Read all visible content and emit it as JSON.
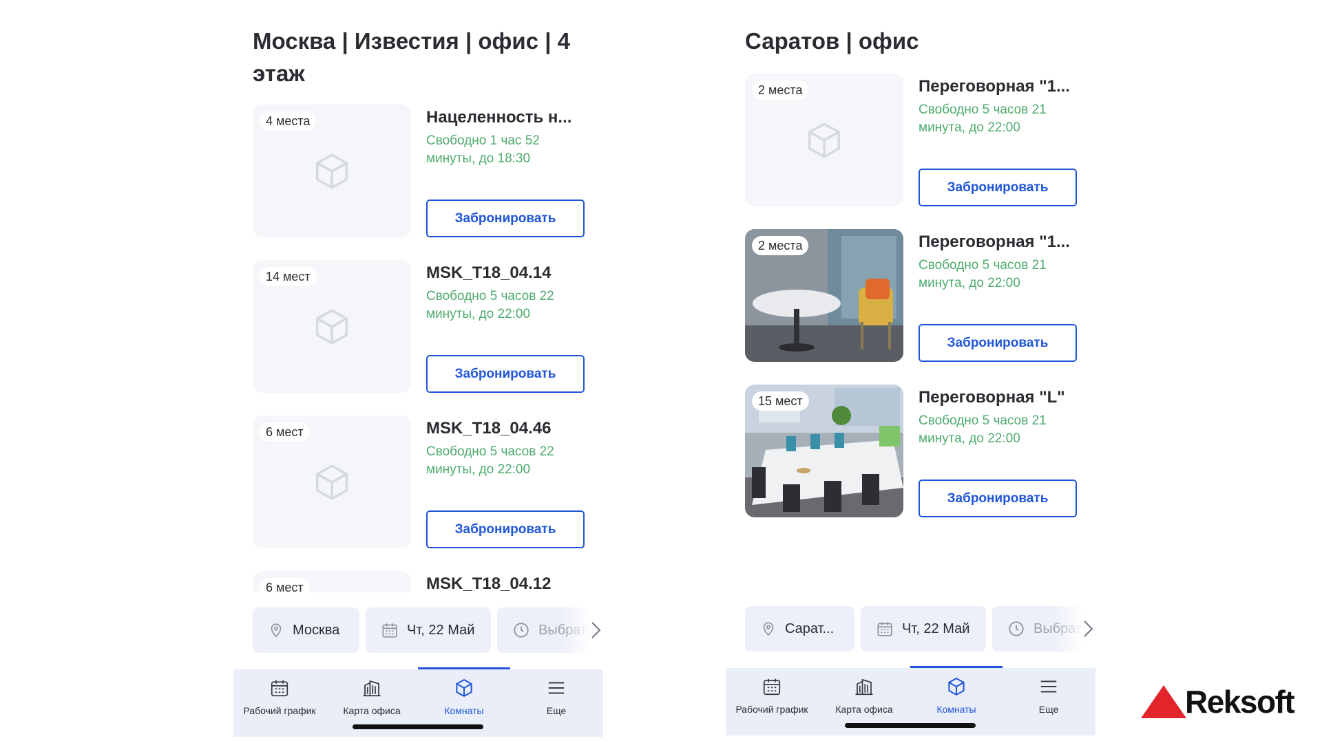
{
  "left_panel": {
    "title": "Москва | Известия | офис | 4 этаж",
    "rooms": [
      {
        "seats": "4 места",
        "name": "Нацеленность н...",
        "status": "Свободно 1 час 52 минуты, до 18:30",
        "photo": "placeholder"
      },
      {
        "seats": "14 мест",
        "name": "MSK_T18_04.14",
        "status": "Свободно 5 часов 22 минуты, до 22:00",
        "photo": "placeholder"
      },
      {
        "seats": "6 мест",
        "name": "MSK_T18_04.46",
        "status": "Свободно 5 часов 22 минуты, до 22:00",
        "photo": "placeholder"
      },
      {
        "seats": "6 мест",
        "name": "MSK_T18_04.12",
        "status": "",
        "photo": "placeholder"
      }
    ],
    "filters": {
      "city": "Москва",
      "date": "Чт, 22 Май",
      "time": "Выбрать"
    }
  },
  "right_panel": {
    "title": "Саратов | офис",
    "rooms": [
      {
        "seats": "2 места",
        "name": "Переговорная \"1...",
        "status": "Свободно 5 часов 21 минута, до 22:00",
        "photo": "placeholder"
      },
      {
        "seats": "2 места",
        "name": "Переговорная \"1...",
        "status": "Свободно 5 часов 21 минута, до 22:00",
        "photo": "lounge-photo"
      },
      {
        "seats": "15 мест",
        "name": "Переговорная \"L\"",
        "status": "Свободно 5 часов 21 минута, до 22:00",
        "photo": "conference-photo"
      }
    ],
    "filters": {
      "city": "Сарат...",
      "date": "Чт, 22 Май",
      "time": "Выбрать"
    }
  },
  "book_label": "Забронировать",
  "tabs": [
    {
      "label": "Рабочий график",
      "icon": "calendar-icon"
    },
    {
      "label": "Карта офиса",
      "icon": "building-icon"
    },
    {
      "label": "Комнаты",
      "icon": "cube-icon",
      "active": true
    },
    {
      "label": "Еще",
      "icon": "menu-icon"
    }
  ],
  "brand": {
    "name": "Reksoft",
    "accent": "#e3242b"
  },
  "colors": {
    "primary": "#1f56d8",
    "status_green": "#4dab6d",
    "tabbar": "#eaeef9",
    "chip": "#edf0f8"
  }
}
